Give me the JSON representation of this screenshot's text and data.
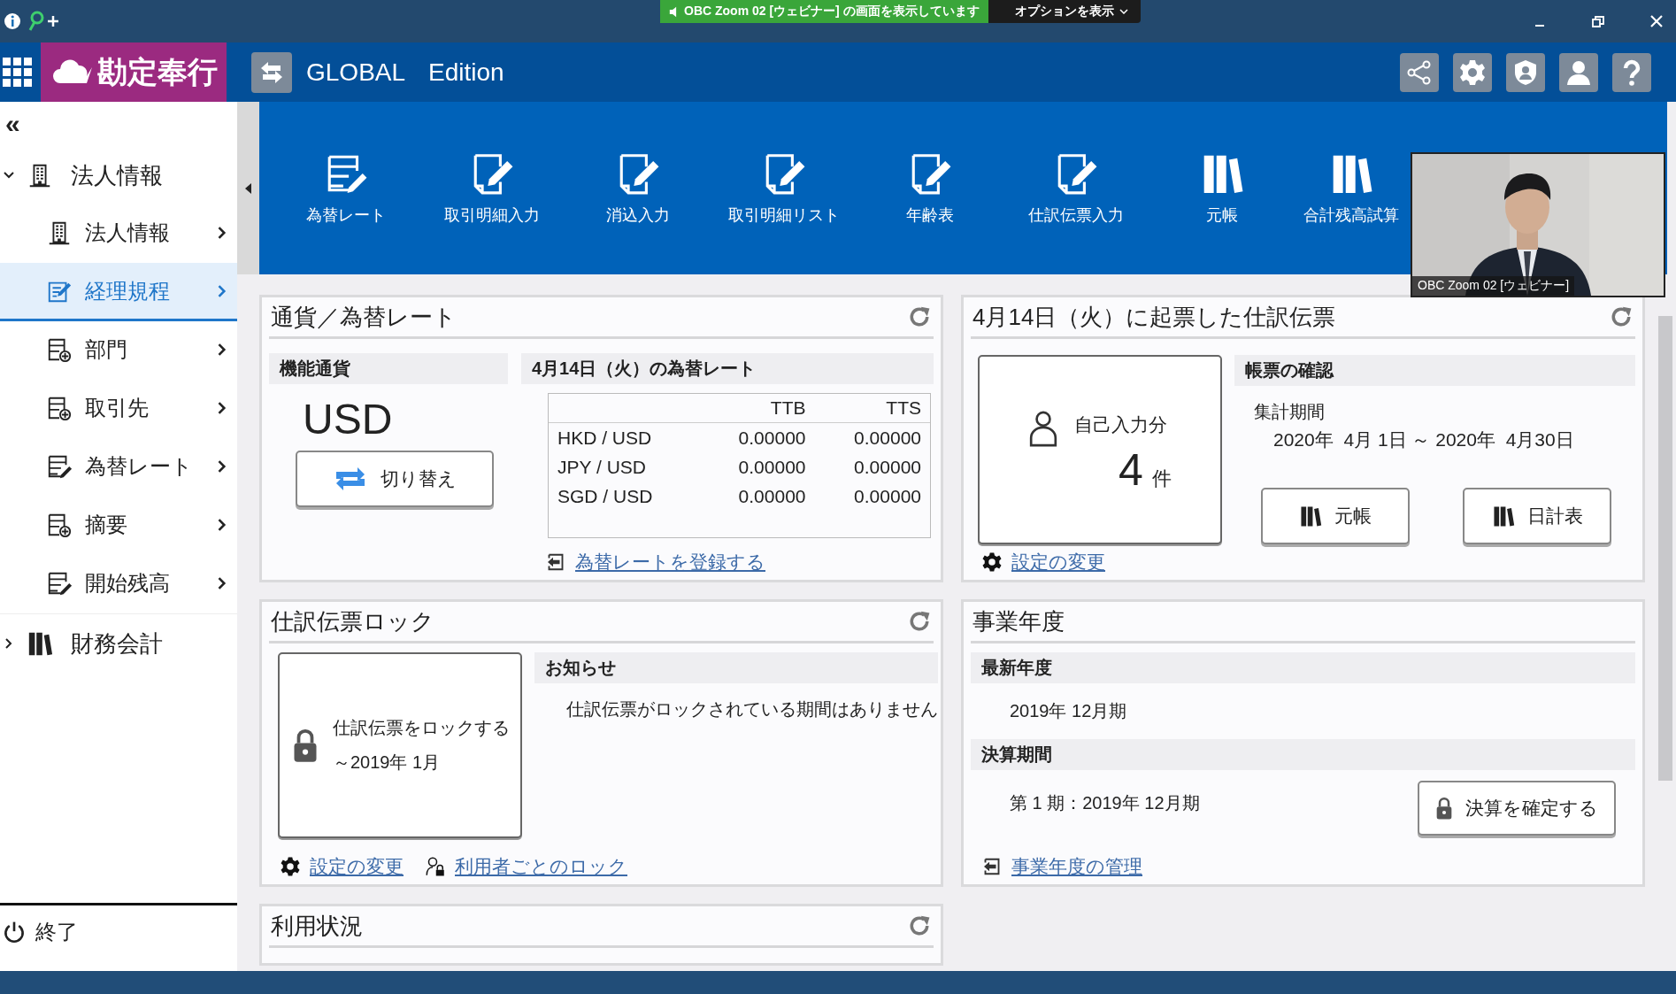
{
  "title_bar": {
    "share_notice": "OBC Zoom 02 [ウェビナー] の画面を表示しています",
    "options_button": "オプションを表示"
  },
  "header": {
    "logo": "勘定奉行",
    "title": "GLOBAL",
    "edition": "Edition"
  },
  "sidebar": {
    "collapse": "«",
    "groups": [
      {
        "label": "法人情報",
        "kind": "building",
        "expanded": true,
        "children": [
          {
            "label": "法人情報",
            "kind": "building",
            "selected": false
          },
          {
            "label": "経理規程",
            "kind": "edit",
            "selected": true
          },
          {
            "label": "部門",
            "kind": "list-plus",
            "selected": false
          },
          {
            "label": "取引先",
            "kind": "list-plus",
            "selected": false
          },
          {
            "label": "為替レート",
            "kind": "list-pen",
            "selected": false
          },
          {
            "label": "摘要",
            "kind": "list-plus",
            "selected": false
          },
          {
            "label": "開始残高",
            "kind": "list-pen",
            "selected": false
          }
        ]
      },
      {
        "label": "財務会計",
        "kind": "books",
        "expanded": false
      }
    ],
    "exit": "終了"
  },
  "toolbar": {
    "items": [
      {
        "label": "為替レート",
        "kind": "list-pen"
      },
      {
        "label": "取引明細入力",
        "kind": "doc-pen"
      },
      {
        "label": "消込入力",
        "kind": "doc-pen"
      },
      {
        "label": "取引明細リスト",
        "kind": "doc-pen"
      },
      {
        "label": "年齢表",
        "kind": "doc-pen"
      },
      {
        "label": "仕訳伝票入力",
        "kind": "doc-pen"
      },
      {
        "label": "元帳",
        "kind": "books"
      },
      {
        "label": "合計残高試算",
        "kind": "books"
      }
    ]
  },
  "video": {
    "caption": "OBC Zoom 02 [ウェビナー]"
  },
  "panels": {
    "exchange": {
      "title": "通貨／為替レート",
      "functional_currency": {
        "heading": "機能通貨",
        "value": "USD",
        "button": "切り替え"
      },
      "rates": {
        "heading": "4月14日（火）の為替レート",
        "columns": [
          "TTB",
          "TTS"
        ],
        "rows": [
          {
            "pair": "HKD / USD",
            "ttb": "0.00000",
            "tts": "0.00000"
          },
          {
            "pair": "JPY / USD",
            "ttb": "0.00000",
            "tts": "0.00000"
          },
          {
            "pair": "SGD / USD",
            "ttb": "0.00000",
            "tts": "0.00000"
          }
        ]
      },
      "link": "為替レートを登録する"
    },
    "vouchers": {
      "title": "4月14日（火）に起票した仕訳伝票",
      "own_entries": {
        "label": "自己入力分",
        "count": "4",
        "unit": "件"
      },
      "reports": {
        "heading": "帳票の確認",
        "period_label": "集計期間",
        "period": "2020年  4月 1日 ～ 2020年  4月30日",
        "buttons": [
          "元帳",
          "日計表"
        ]
      },
      "link": "設定の変更"
    },
    "lock": {
      "title": "仕訳伝票ロック",
      "lock_card": {
        "label": "仕訳伝票をロックする",
        "until": "～2019年 1月"
      },
      "notice": {
        "heading": "お知らせ",
        "message": "仕訳伝票がロックされている期間はありません"
      },
      "links": [
        {
          "label": "設定の変更",
          "kind": "gear"
        },
        {
          "label": "利用者ごとのロック",
          "kind": "user-lock"
        }
      ]
    },
    "fiscal_year": {
      "title": "事業年度",
      "latest": {
        "heading": "最新年度",
        "value": "2019年 12月期"
      },
      "closing": {
        "heading": "決算期間",
        "value": "第 1 期：2019年 12月期",
        "button": "決算を確定する"
      },
      "link": "事業年度の管理"
    },
    "usage": {
      "title": "利用状況"
    }
  }
}
